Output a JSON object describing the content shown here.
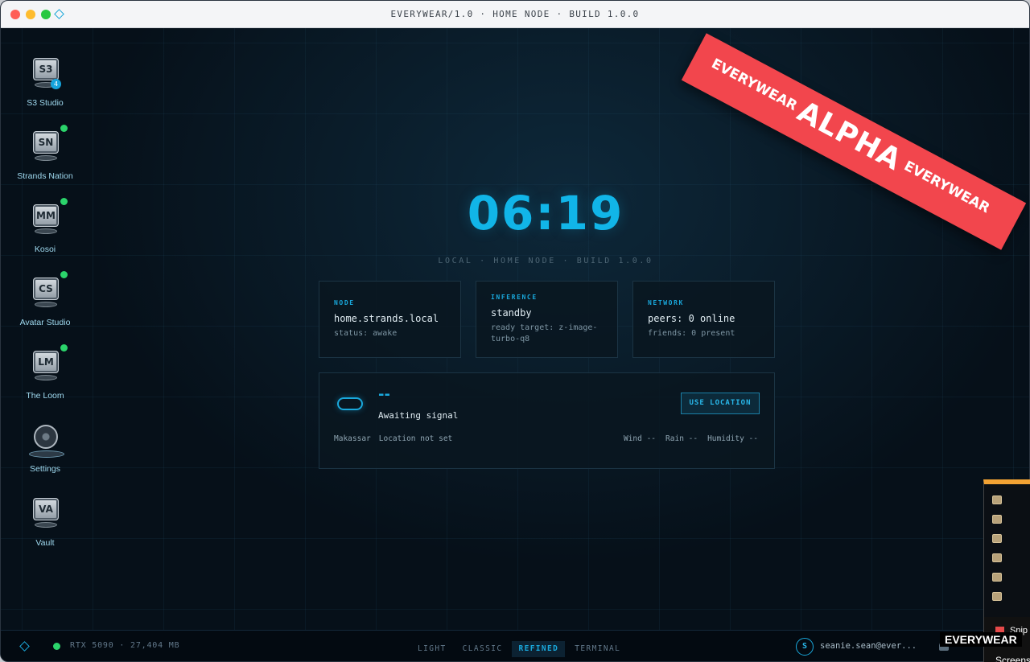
{
  "window": {
    "title": "EVERYWEAR/1.0 · HOME NODE · BUILD 1.0.0"
  },
  "dock": [
    {
      "abbr": "S3",
      "label": "S3 Studio",
      "badge": "4",
      "status": ""
    },
    {
      "abbr": "SN",
      "label": "Strands Nation",
      "badge": "",
      "status": "online"
    },
    {
      "abbr": "MM",
      "label": "Kosoi",
      "badge": "",
      "status": "online"
    },
    {
      "abbr": "CS",
      "label": "Avatar Studio",
      "badge": "",
      "status": "online"
    },
    {
      "abbr": "LM",
      "label": "The Loom",
      "badge": "",
      "status": "online"
    },
    {
      "abbr": "",
      "label": "Settings",
      "badge": "",
      "status": ""
    },
    {
      "abbr": "VA",
      "label": "Vault",
      "badge": "",
      "status": ""
    }
  ],
  "clock": {
    "time": "06:19",
    "subline": "LOCAL · HOME NODE · BUILD 1.0.0"
  },
  "cards": {
    "node": {
      "label": "NODE",
      "main": "home.strands.local",
      "sub": "status: awake"
    },
    "inference": {
      "label": "INFERENCE",
      "main": "standby",
      "sub": "ready target: z-image-turbo-q8"
    },
    "network": {
      "label": "NETWORK",
      "main": "peers: 0 online",
      "sub": "friends: 0 present"
    }
  },
  "weather": {
    "temp": "--",
    "condition": "Awaiting signal",
    "button": "USE LOCATION",
    "city": "Makassar",
    "location_status": "Location not set",
    "wind": "Wind --",
    "rain": "Rain --",
    "humidity": "Humidity --"
  },
  "banner": {
    "left": "EVERYWEAR",
    "center": "ALPHA",
    "right": "EVERYWEAR"
  },
  "bottombar": {
    "gpu": "RTX 5090 · 27,404 MB",
    "themes": [
      "LIGHT",
      "CLASSIC",
      "REFINED",
      "TERMINAL"
    ],
    "active_theme": "REFINED",
    "avatar_initial": "S",
    "user": "seanie.sean@ever..."
  },
  "overlay": {
    "snip": "Snip",
    "screens": "Screens",
    "everywear": "EVERYWEAR"
  },
  "colors": {
    "accent": "#19a8dc",
    "online": "#2bd46b",
    "banner": "#f2464d",
    "background": "#061019"
  }
}
